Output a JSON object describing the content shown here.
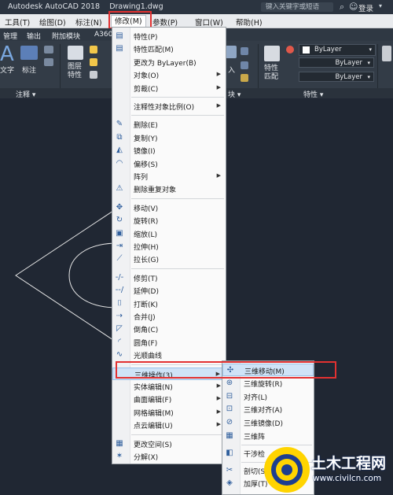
{
  "title_bar": {
    "app_title": "Autodesk AutoCAD 2018",
    "doc_title": "Drawing1.dwg",
    "search_placeholder": "键入关键字或短语",
    "login": "登录"
  },
  "menubar": [
    {
      "label": "工具(T)"
    },
    {
      "label": "绘图(D)"
    },
    {
      "label": "标注(N)"
    },
    {
      "label": "修改(M)"
    },
    {
      "label": "参数(P)"
    },
    {
      "label": "窗口(W)"
    },
    {
      "label": "帮助(H)"
    }
  ],
  "ribbon_tabs": [
    "管理",
    "输出",
    "附加模块",
    "A360"
  ],
  "ribbon": {
    "text_label": "文字",
    "dim_label": "标注",
    "layer_props_label": "图层\n特性",
    "insert_label": "入",
    "match_label": "特性\n匹配",
    "bylayer_1": "ByLayer",
    "bylayer_2": "ByLayer",
    "bylayer_3": "ByLayer"
  },
  "panel_titles": {
    "annotation": "注释 ▾",
    "block": "块 ▾",
    "properties": "特性 ▾"
  },
  "modify_menu": {
    "items": [
      {
        "icon": "properties-icon",
        "glyph": "▤",
        "label": "特性(P)"
      },
      {
        "icon": "match-properties-icon",
        "glyph": "▤",
        "label": "特性匹配(M)"
      },
      {
        "icon": "",
        "glyph": "",
        "label": "更改为 ByLayer(B)"
      },
      {
        "icon": "",
        "glyph": "",
        "label": "对象(O)",
        "submenu": true
      },
      {
        "icon": "",
        "glyph": "",
        "label": "剪裁(C)",
        "submenu": true
      },
      {
        "divider": true
      },
      {
        "icon": "",
        "glyph": "",
        "label": "注释性对象比例(O)",
        "submenu": true
      },
      {
        "divider": true
      },
      {
        "icon": "erase-icon",
        "glyph": "✎",
        "label": "删除(E)"
      },
      {
        "icon": "copy-icon",
        "glyph": "⧉",
        "label": "复制(Y)"
      },
      {
        "icon": "mirror-icon",
        "glyph": "◭",
        "label": "镜像(I)"
      },
      {
        "icon": "offset-icon",
        "glyph": "◠",
        "label": "偏移(S)"
      },
      {
        "icon": "",
        "glyph": "",
        "label": "阵列",
        "submenu": true
      },
      {
        "icon": "delete-duplicates-icon",
        "glyph": "⚠",
        "label": "删除重复对象"
      },
      {
        "divider": true
      },
      {
        "icon": "move-icon",
        "glyph": "✥",
        "label": "移动(V)"
      },
      {
        "icon": "rotate-icon",
        "glyph": "↻",
        "label": "旋转(R)"
      },
      {
        "icon": "scale-icon",
        "glyph": "▣",
        "label": "缩放(L)"
      },
      {
        "icon": "stretch-icon",
        "glyph": "⇥",
        "label": "拉伸(H)"
      },
      {
        "icon": "lengthen-icon",
        "glyph": "⟋",
        "label": "拉长(G)"
      },
      {
        "divider": true
      },
      {
        "icon": "trim-icon",
        "glyph": "-/-",
        "label": "修剪(T)"
      },
      {
        "icon": "extend-icon",
        "glyph": "--/",
        "label": "延伸(D)"
      },
      {
        "icon": "break-icon",
        "glyph": "⌷",
        "label": "打断(K)"
      },
      {
        "icon": "join-icon",
        "glyph": "⇢",
        "label": "合并(J)"
      },
      {
        "icon": "chamfer-icon",
        "glyph": "◸",
        "label": "倒角(C)"
      },
      {
        "icon": "fillet-icon",
        "glyph": "◜",
        "label": "圆角(F)"
      },
      {
        "icon": "blend-curves-icon",
        "glyph": "∿",
        "label": "光顺曲线"
      },
      {
        "divider": true
      },
      {
        "icon": "",
        "glyph": "",
        "label": "三维操作(3)",
        "submenu": true,
        "highlight": true
      },
      {
        "icon": "",
        "glyph": "",
        "label": "实体编辑(N)",
        "submenu": true
      },
      {
        "icon": "",
        "glyph": "",
        "label": "曲面编辑(F)",
        "submenu": true
      },
      {
        "icon": "",
        "glyph": "",
        "label": "网格编辑(M)",
        "submenu": true
      },
      {
        "icon": "",
        "glyph": "",
        "label": "点云编辑(U)",
        "submenu": true
      },
      {
        "divider": true
      },
      {
        "icon": "change-space-icon",
        "glyph": "▦",
        "label": "更改空间(S)"
      },
      {
        "icon": "explode-icon",
        "glyph": "✶",
        "label": "分解(X)"
      }
    ]
  },
  "submenu_3d": {
    "items": [
      {
        "icon": "3d-move-icon",
        "glyph": "✣",
        "label": "三维移动(M)",
        "highlight": true
      },
      {
        "icon": "3d-rotate-icon",
        "glyph": "⊛",
        "label": "三维旋转(R)"
      },
      {
        "icon": "align-icon",
        "glyph": "⊟",
        "label": "对齐(L)"
      },
      {
        "icon": "3d-align-icon",
        "glyph": "⊡",
        "label": "三维对齐(A)"
      },
      {
        "icon": "3d-mirror-icon",
        "glyph": "⊘",
        "label": "三维镜像(D)"
      },
      {
        "icon": "3d-array-icon",
        "glyph": "▦",
        "label": "三维阵"
      },
      {
        "divider": true
      },
      {
        "icon": "interfere-icon",
        "glyph": "◧",
        "label": "干涉检"
      },
      {
        "divider": true
      },
      {
        "icon": "slice-icon",
        "glyph": "✂",
        "label": "剖切(S)"
      },
      {
        "icon": "thicken-icon",
        "glyph": "◈",
        "label": "加厚(T)"
      }
    ]
  },
  "watermark": {
    "title": "土木工程网",
    "url": "www.civilcn.com"
  }
}
